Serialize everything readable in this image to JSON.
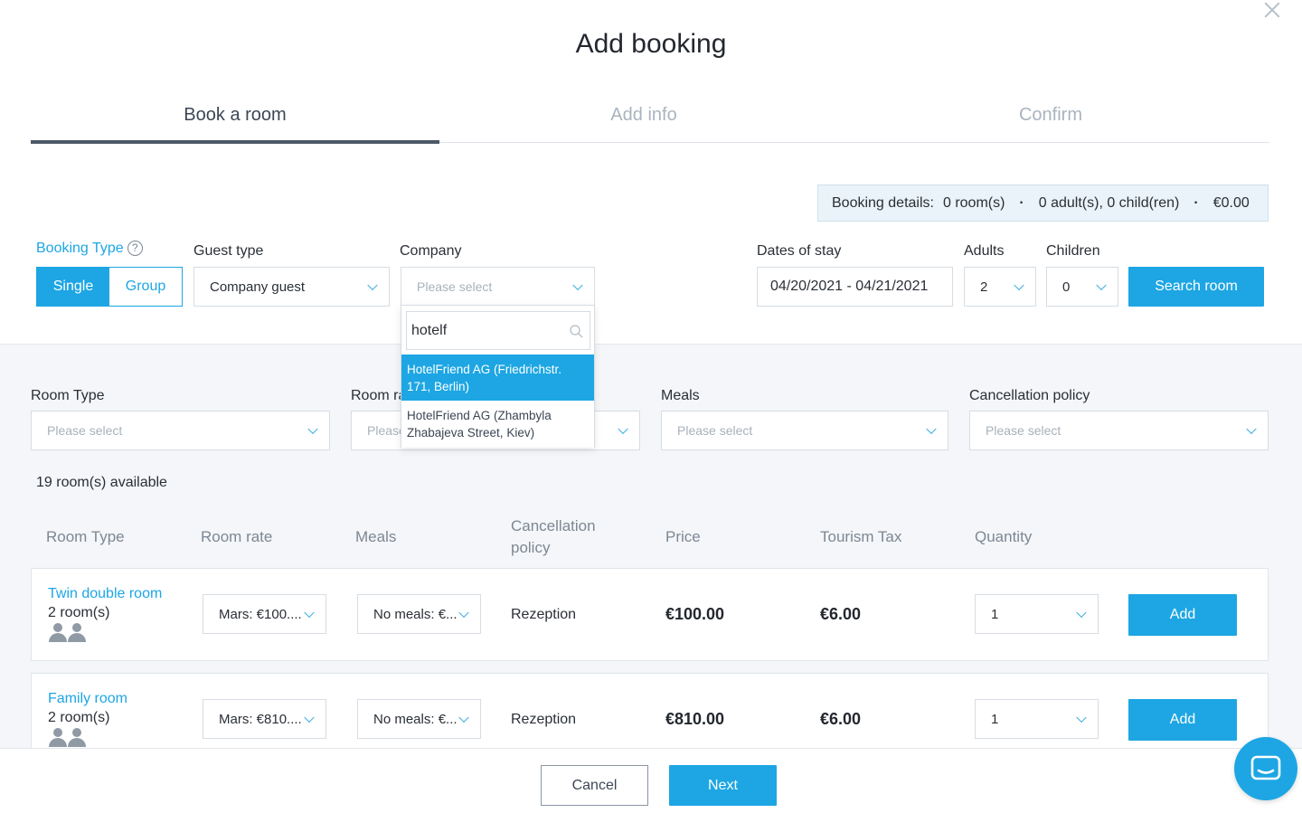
{
  "title": "Add booking",
  "steps": [
    {
      "label": "Book a room",
      "active": true
    },
    {
      "label": "Add info",
      "active": false
    },
    {
      "label": "Confirm",
      "active": false
    }
  ],
  "booking_details": {
    "label": "Booking details:",
    "rooms": "0 room(s)",
    "guests": "0 adult(s), 0 child(ren)",
    "total": "€0.00"
  },
  "search_form": {
    "booking_type_label": "Booking Type",
    "booking_type_options": [
      "Single",
      "Group"
    ],
    "booking_type_selected": "Single",
    "guest_type_label": "Guest type",
    "guest_type_value": "Company guest",
    "company_label": "Company",
    "company_placeholder": "Please select",
    "dates_label": "Dates of stay",
    "dates_value": "04/20/2021 - 04/21/2021",
    "adults_label": "Adults",
    "adults_value": "2",
    "children_label": "Children",
    "children_value": "0",
    "search_button": "Search room"
  },
  "company_dropdown": {
    "search_value": "hotelf",
    "options": [
      {
        "line1": "HotelFriend AG (Friedrichstr.",
        "line2": "171, Berlin)",
        "highlighted": true
      },
      {
        "line1": "HotelFriend AG (Zhambyla",
        "line2": "Zhabajeva Street, Kiev)",
        "highlighted": false
      }
    ]
  },
  "filters": {
    "room_type_label": "Room Type",
    "room_rate_label": "Room ra",
    "meals_label": "Meals",
    "cancellation_label": "Cancellation policy",
    "placeholder": "Please select",
    "room_rate_placeholder_visible": "Please"
  },
  "available_text": "19 room(s) available",
  "table": {
    "headers": {
      "room_type": "Room Type",
      "room_rate": "Room rate",
      "meals": "Meals",
      "cancellation_line1": "Cancellation",
      "cancellation_line2": "policy",
      "price": "Price",
      "tourism_tax": "Tourism Tax",
      "quantity": "Quantity"
    },
    "rows": [
      {
        "room_type": "Twin double room",
        "room_count": "2 room(s)",
        "room_rate": "Mars: €100....",
        "meals": "No meals: €...",
        "cancellation": "Rezeption",
        "price": "€100.00",
        "tourism_tax": "€6.00",
        "quantity": "1",
        "add_label": "Add"
      },
      {
        "room_type": "Family room",
        "room_count": "2 room(s)",
        "room_rate": "Mars: €810....",
        "meals": "No meals: €...",
        "cancellation": "Rezeption",
        "price": "€810.00",
        "tourism_tax": "€6.00",
        "quantity": "1",
        "add_label": "Add"
      }
    ]
  },
  "footer": {
    "cancel_label": "Cancel",
    "next_label": "Next"
  },
  "colors": {
    "accent": "#1da6e3",
    "active_step": "#4b5968",
    "section_bg": "#f4f6f9"
  }
}
